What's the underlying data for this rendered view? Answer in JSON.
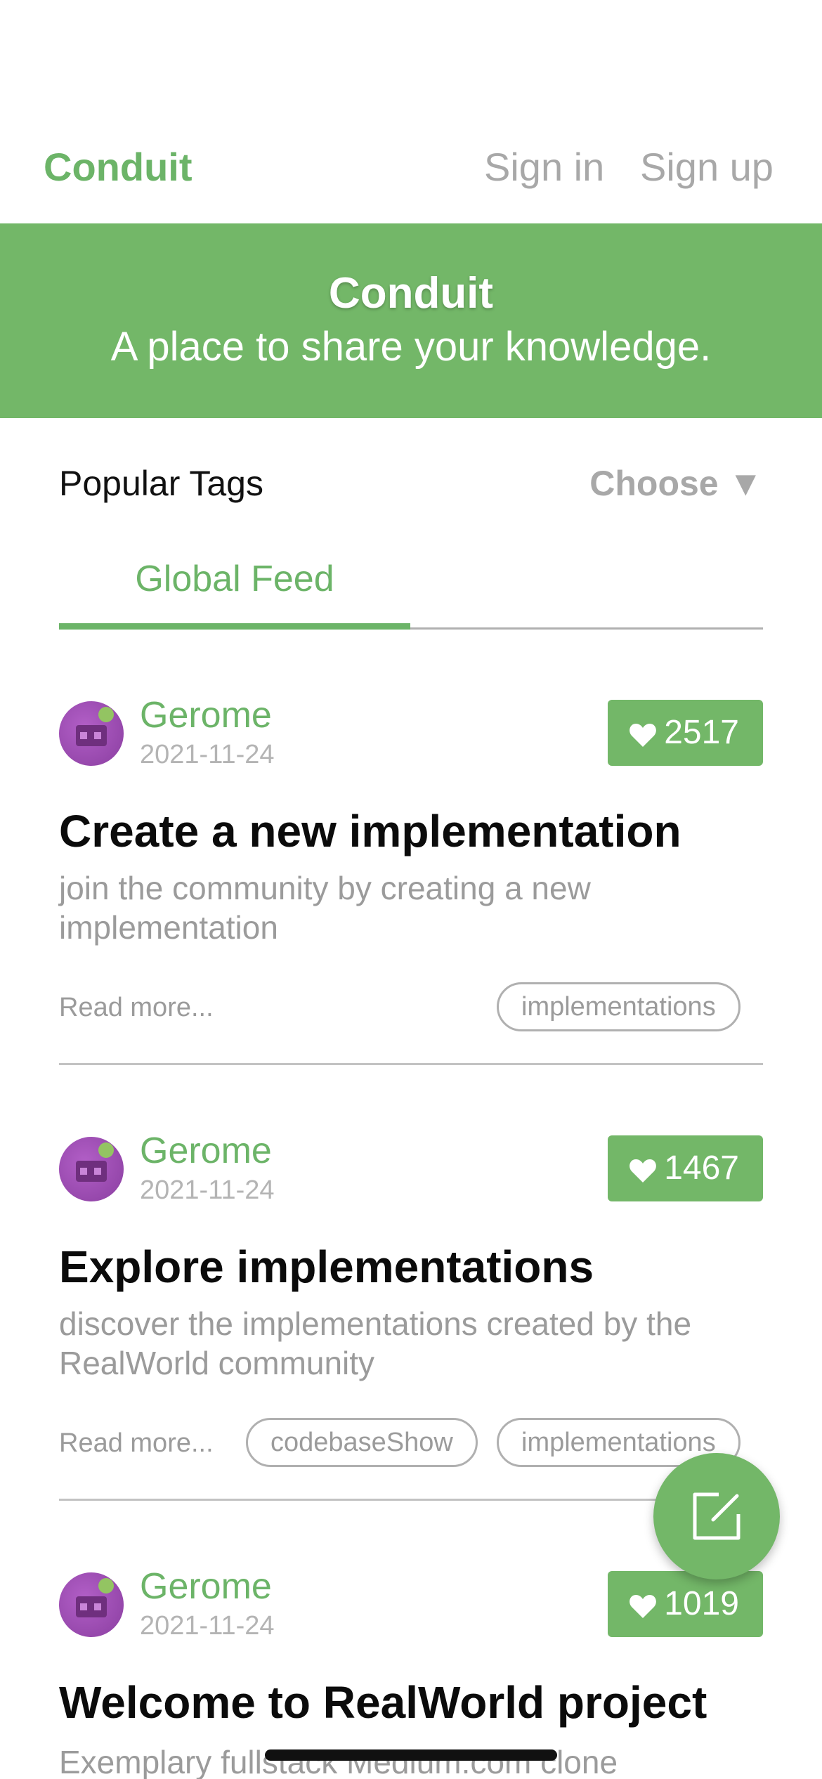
{
  "navbar": {
    "brand": "Conduit",
    "sign_in": "Sign in",
    "sign_up": "Sign up"
  },
  "banner": {
    "title": "Conduit",
    "subtitle": "A place to share your knowledge."
  },
  "tags": {
    "title": "Popular Tags",
    "choose": "Choose ▼"
  },
  "feed": {
    "tab_label": "Global Feed"
  },
  "articles": [
    {
      "author": "Gerome",
      "date": "2021-11-24",
      "likes": "2517",
      "title": "Create a new implementation",
      "description": "join the community by creating a new implementation",
      "read_more": "Read more...",
      "tags": [
        "implementations"
      ]
    },
    {
      "author": "Gerome",
      "date": "2021-11-24",
      "likes": "1467",
      "title": "Explore implementations",
      "description": "discover the implementations created by the RealWorld community",
      "read_more": "Read more...",
      "tags": [
        "codebaseShow",
        "implementations"
      ]
    },
    {
      "author": "Gerome",
      "date": "2021-11-24",
      "likes": "1019",
      "title": "Welcome to RealWorld project",
      "description": "Exemplary fullstack Medium.com clone"
    }
  ],
  "icons": {
    "like": "heart-icon",
    "fab": "edit-icon"
  },
  "colors": {
    "brand_green": "#73b768",
    "muted_text": "#9b9b9b"
  }
}
